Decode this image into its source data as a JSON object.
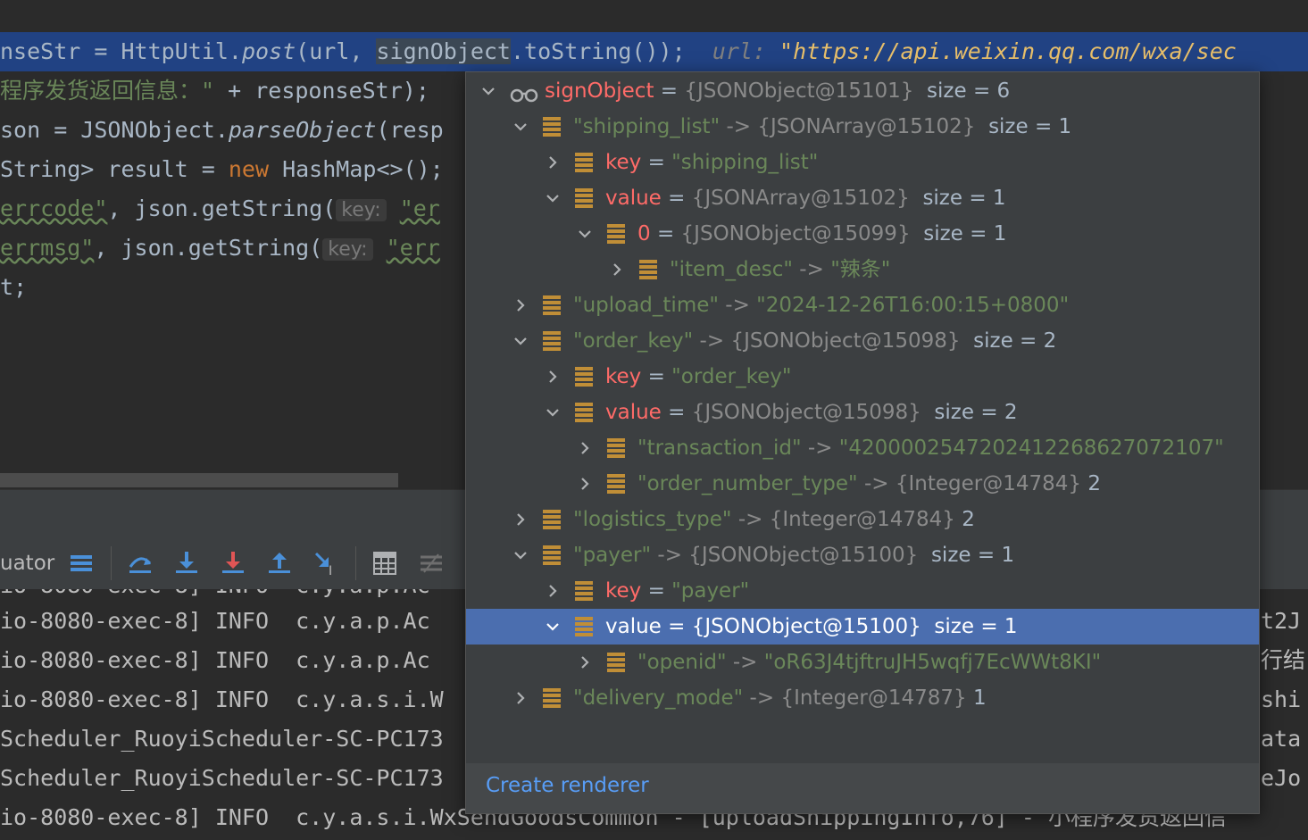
{
  "editor": {
    "line0": {
      "p1": "nseStr = HttpUtil.",
      "p2": "post",
      "p3": "(url, ",
      "p4": "signObject",
      "p5": ".toString());",
      "hint_label": "url:",
      "hint_value": "\"https://api.weixin.qq.com/wxa/sec"
    },
    "line1": {
      "s": "程序发货返回信息：\"",
      "rest": " + responseStr);"
    },
    "line2": {
      "p1": "son = JSONObject.",
      "p2": "parseObject",
      "p3": "(resp"
    },
    "line3": {
      "p1": "String> result = ",
      "kw": "new",
      "p2": " HashMap<>();"
    },
    "line4": {
      "s": "errcode\"",
      "p1": ", json.getString(",
      "hint": "key:",
      "s2": "\"er"
    },
    "line5": {
      "s": "errmsg\"",
      "p1": ", json.getString(",
      "hint": "key:",
      "s2": "\"err"
    },
    "line6": {
      "p1": "t;"
    }
  },
  "toolbar": {
    "label": "uator"
  },
  "console": {
    "lines": [
      {
        "left": "io-8080-exec-8] INFO  c.y.a.p.Ac",
        "right": "t2J"
      },
      {
        "left": "io-8080-exec-8] INFO  c.y.a.p.Ac",
        "right": "行结"
      },
      {
        "left": "io-8080-exec-8] INFO  c.y.a.s.i.W",
        "right": "shi"
      },
      {
        "left": "Scheduler_RuoyiScheduler-SC-PC173",
        "right": "ata"
      },
      {
        "left": "Scheduler_RuoyiScheduler-SC-PC173",
        "right": "eJo"
      },
      {
        "left": "io-8080-exec-8] INFO  c.y.a.s.i.WxSendGoodsCommon - [uploadShippingInfo,76] - 小程序发货返回信",
        "right": ""
      }
    ]
  },
  "popup": {
    "nodes": [
      {
        "arrow": "down",
        "indent": 0,
        "icon": "watch",
        "name": "signObject",
        "sep": " = ",
        "ref": "{JSONObject@15101}",
        "size": "size = 6"
      },
      {
        "arrow": "down",
        "indent": 1,
        "icon": "field",
        "key": "\"shipping_list\"",
        "sep": " -> ",
        "ref": "{JSONArray@15102}",
        "size": "size = 1"
      },
      {
        "arrow": "right",
        "indent": 2,
        "icon": "field",
        "name": "key",
        "sep": " = ",
        "strval": "\"shipping_list\""
      },
      {
        "arrow": "down",
        "indent": 2,
        "icon": "field",
        "name": "value",
        "sep": " = ",
        "ref": "{JSONArray@15102}",
        "size": "size = 1"
      },
      {
        "arrow": "down",
        "indent": 3,
        "icon": "field",
        "name": "0",
        "sep": " = ",
        "ref": "{JSONObject@15099}",
        "size": "size = 1"
      },
      {
        "arrow": "right",
        "indent": 4,
        "icon": "field",
        "key": "\"item_desc\"",
        "sep": " -> ",
        "strval": "\"辣条\""
      },
      {
        "arrow": "right",
        "indent": 1,
        "icon": "field",
        "key": "\"upload_time\"",
        "sep": " -> ",
        "strval": "\"2024-12-26T16:00:15+0800\""
      },
      {
        "arrow": "down",
        "indent": 1,
        "icon": "field",
        "key": "\"order_key\"",
        "sep": " -> ",
        "ref": "{JSONObject@15098}",
        "size": "size = 2"
      },
      {
        "arrow": "right",
        "indent": 2,
        "icon": "field",
        "name": "key",
        "sep": " = ",
        "strval": "\"order_key\""
      },
      {
        "arrow": "down",
        "indent": 2,
        "icon": "field",
        "name": "value",
        "sep": " = ",
        "ref": "{JSONObject@15098}",
        "size": "size = 2"
      },
      {
        "arrow": "right",
        "indent": 3,
        "icon": "field",
        "key": "\"transaction_id\"",
        "sep": " -> ",
        "strval": "\"4200002547202412268627072107\""
      },
      {
        "arrow": "right",
        "indent": 3,
        "icon": "field",
        "key": "\"order_number_type\"",
        "sep": " -> ",
        "ref": "{Integer@14784}",
        "num": "2"
      },
      {
        "arrow": "right",
        "indent": 1,
        "icon": "field",
        "key": "\"logistics_type\"",
        "sep": " -> ",
        "ref": "{Integer@14784}",
        "num": "2"
      },
      {
        "arrow": "down",
        "indent": 1,
        "icon": "field",
        "key": "\"payer\"",
        "sep": " -> ",
        "ref": "{JSONObject@15100}",
        "size": "size = 1"
      },
      {
        "arrow": "right",
        "indent": 2,
        "icon": "field",
        "name": "key",
        "sep": " = ",
        "strval": "\"payer\""
      },
      {
        "arrow": "down",
        "indent": 2,
        "icon": "field",
        "name": "value",
        "sep": " = ",
        "ref": "{JSONObject@15100}",
        "size": "size = 1",
        "selected": true
      },
      {
        "arrow": "right",
        "indent": 3,
        "icon": "field",
        "key": "\"openid\"",
        "sep": " -> ",
        "strval": "\"oR63J4tjftruJH5wqfj7EcWWt8KI\""
      },
      {
        "arrow": "right",
        "indent": 1,
        "icon": "field",
        "key": "\"delivery_mode\"",
        "sep": " -> ",
        "ref": "{Integer@14787}",
        "num": "1"
      }
    ],
    "footer": "Create renderer"
  }
}
